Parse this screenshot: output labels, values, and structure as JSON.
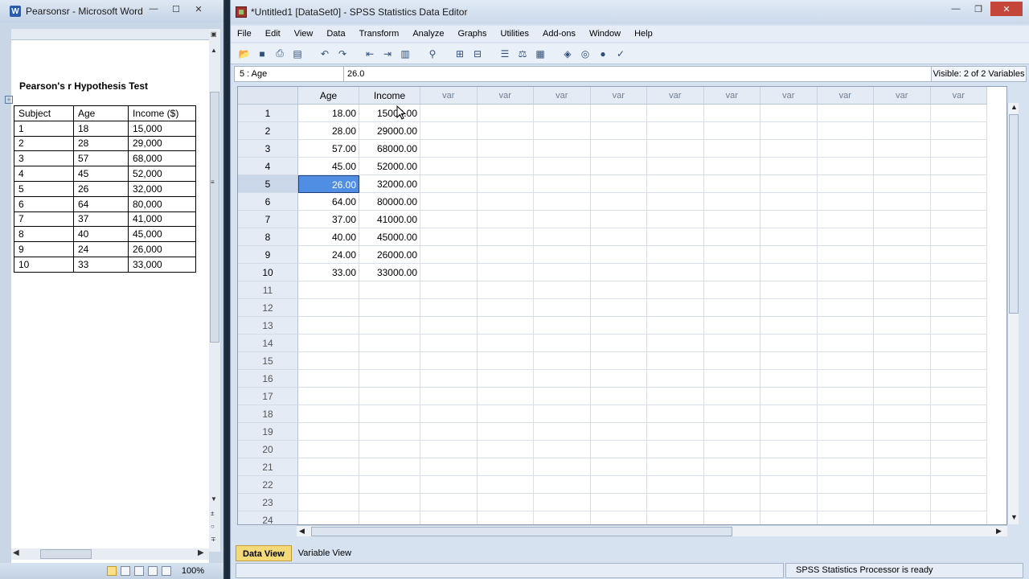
{
  "word": {
    "title": "Pearsonsr - Microsoft Word",
    "app_icon": "W",
    "doc_title": "Pearson's r Hypothesis Test",
    "table": {
      "headers": [
        "Subject",
        "Age",
        "Income ($)"
      ],
      "rows": [
        [
          "1",
          "18",
          "15,000"
        ],
        [
          "2",
          "28",
          "29,000"
        ],
        [
          "3",
          "57",
          "68,000"
        ],
        [
          "4",
          "45",
          "52,000"
        ],
        [
          "5",
          "26",
          "32,000"
        ],
        [
          "6",
          "64",
          "80,000"
        ],
        [
          "7",
          "37",
          "41,000"
        ],
        [
          "8",
          "40",
          "45,000"
        ],
        [
          "9",
          "24",
          "26,000"
        ],
        [
          "10",
          "33",
          "33,000"
        ]
      ]
    },
    "zoom": "100%"
  },
  "spss": {
    "title": "*Untitled1 [DataSet0] - SPSS Statistics Data Editor",
    "menu": [
      "File",
      "Edit",
      "View",
      "Data",
      "Transform",
      "Analyze",
      "Graphs",
      "Utilities",
      "Add-ons",
      "Window",
      "Help"
    ],
    "toolbar_icons": [
      "open-icon",
      "save-icon",
      "print-icon",
      "dialog-recall-icon",
      "undo-icon",
      "redo-icon",
      "goto-case-icon",
      "goto-variable-icon",
      "variables-icon",
      "find-icon",
      "insert-cases-icon",
      "insert-variable-icon",
      "split-file-icon",
      "weight-cases-icon",
      "select-cases-icon",
      "value-labels-icon",
      "use-sets-icon",
      "show-all-variables-icon",
      "spelling-icon"
    ],
    "cell_ref": "5 : Age",
    "cell_value": "26.0",
    "visible": "Visible: 2 of 2 Variables",
    "columns": [
      "Age",
      "Income",
      "var",
      "var",
      "var",
      "var",
      "var",
      "var",
      "var",
      "var",
      "var",
      "var"
    ],
    "rows": [
      [
        "18.00",
        "15000.00"
      ],
      [
        "28.00",
        "29000.00"
      ],
      [
        "57.00",
        "68000.00"
      ],
      [
        "45.00",
        "52000.00"
      ],
      [
        "26.00",
        "32000.00"
      ],
      [
        "64.00",
        "80000.00"
      ],
      [
        "37.00",
        "41000.00"
      ],
      [
        "40.00",
        "45000.00"
      ],
      [
        "24.00",
        "26000.00"
      ],
      [
        "33.00",
        "33000.00"
      ]
    ],
    "row_count": 24,
    "selected_row": 5,
    "tabs": [
      "Data View",
      "Variable View"
    ],
    "status": "SPSS Statistics  Processor is ready"
  }
}
